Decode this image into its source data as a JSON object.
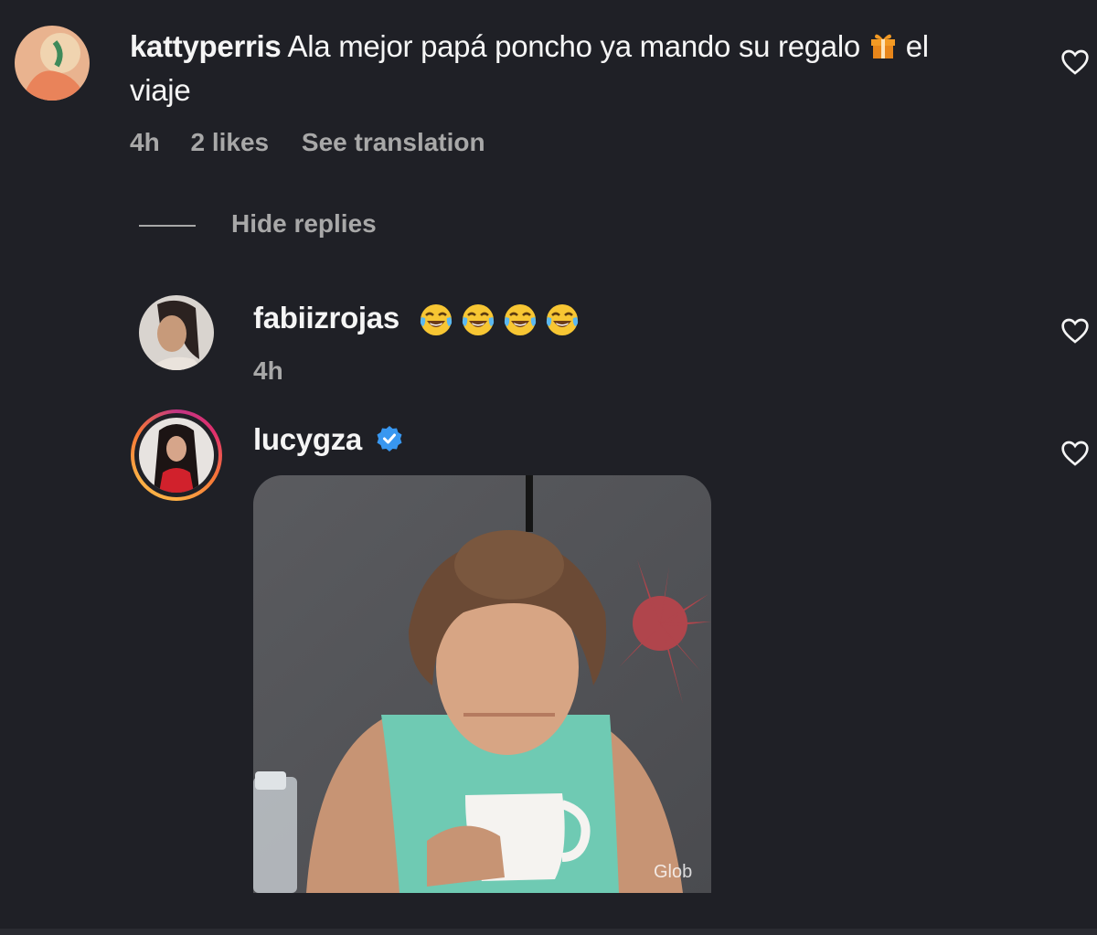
{
  "comment": {
    "username": "kattyperris",
    "text_before_gift": "Ala mejor papá poncho ya mando su regalo",
    "gift_emoji": "wrapped-gift",
    "text_after_gift": "el",
    "text_line2": "viaje",
    "time": "4h",
    "likes": "2 likes",
    "see_translation": "See translation",
    "hide_replies": "Hide replies"
  },
  "replies": [
    {
      "username": "fabiizrojas",
      "emojis": [
        "face-with-tears-of-joy",
        "face-with-tears-of-joy",
        "face-with-tears-of-joy",
        "face-with-tears-of-joy"
      ],
      "time": "4h"
    },
    {
      "username": "lucygza",
      "verified": true,
      "attachment": "gif",
      "gif_watermark": "Glob"
    }
  ],
  "colors": {
    "background": "#1f2026",
    "text": "#f5f5f5",
    "muted": "#a8a8a8",
    "verified": "#3897f0"
  }
}
